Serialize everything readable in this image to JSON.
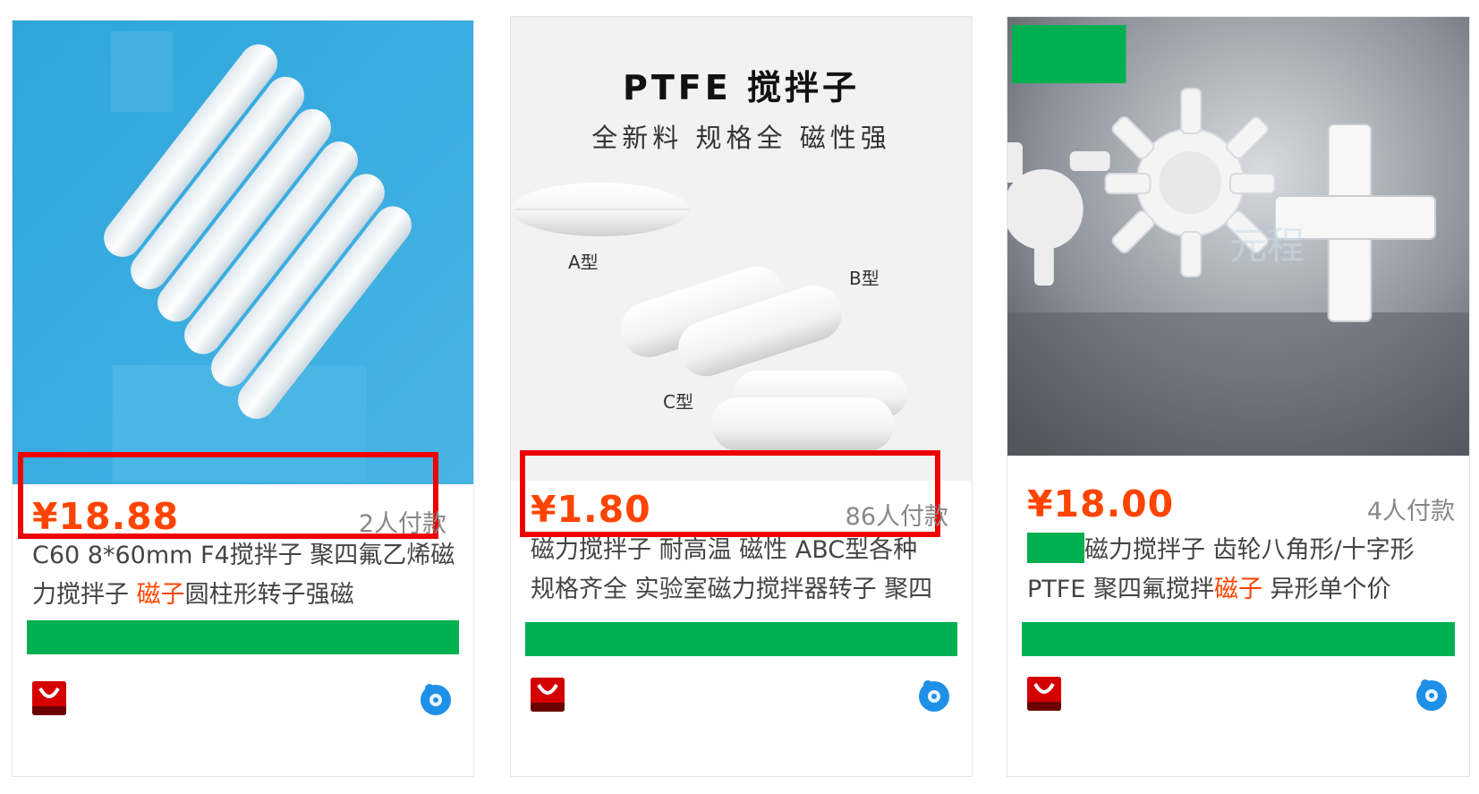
{
  "products": [
    {
      "price": "¥18.88",
      "paid": "2人付款",
      "title_lines": [
        "C60 8*60mm F4搅拌子 聚四氟乙烯磁",
        "力搅拌子 ",
        "磁子",
        "圆柱形转子强磁"
      ],
      "highlighted": true,
      "image_label": "PTFE stir bars cylindrical, blue background"
    },
    {
      "price": "¥1.80",
      "paid": "86人付款",
      "title_lines": [
        "磁力搅拌子 耐高温 磁性 ABC型各种",
        "规格齐全 实验室磁力搅拌器转子 聚四"
      ],
      "highlighted": true,
      "image_text": {
        "headline": "PTFE 搅拌子",
        "subline": "全新料 规格全 磁性强",
        "type_a": "A型",
        "type_b": "B型",
        "type_c": "C型"
      }
    },
    {
      "price": "¥18.00",
      "paid": "4人付款",
      "title_lines": [
        "磁力搅拌子 齿轮八角形/十字形",
        "PTFE 聚四氟搅拌",
        "磁子",
        " 异形单个价"
      ],
      "highlighted": false,
      "image_watermark": "元程"
    }
  ],
  "colors": {
    "price": "#ff4400",
    "highlight_border": "#ee0000",
    "redaction": "#00b050"
  },
  "icons": [
    "shop-logo-icon",
    "wangwang-chat-icon"
  ]
}
